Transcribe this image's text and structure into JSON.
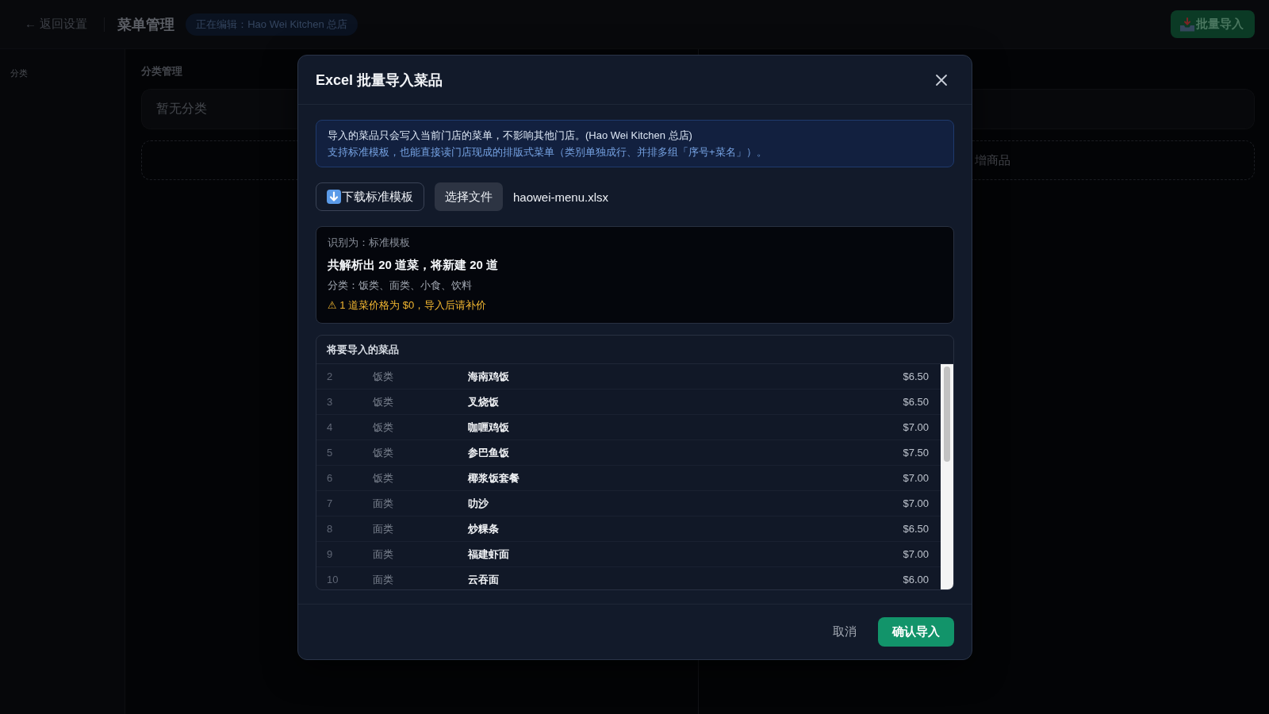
{
  "top_bar": {
    "back_link": "← 返回设置",
    "title": "菜单管理",
    "editing_badge": "正在编辑：Hao Wei Kitchen 总店",
    "bulk_import_button": "批量导入"
  },
  "sidebar": {
    "label": "分类"
  },
  "category_panel": {
    "title": "分类管理",
    "empty_text": "暂无分类"
  },
  "product_panel": {
    "add_button": "增商品"
  },
  "dialog": {
    "title": "Excel 批量导入菜品",
    "notice": {
      "line_1": "导入的菜品只会写入当前门店的菜单，不影响其他门店。(Hao Wei Kitchen 总店)",
      "line_2": "支持标准模板，也能直接读门店现成的排版式菜单（类别单独成行、并排多组「序号+菜名」）。"
    },
    "download_button": "下载标准模板",
    "choose_file_button": "选择文件",
    "file_name": "haowei-menu.xlsx",
    "summary": {
      "detected": "识别为：标准模板",
      "headline": "共解析出 20 道菜，将新建 20 道",
      "categories": "分类：饭类、面类、小食、饮料",
      "warning": "⚠ 1 道菜价格为 $0，导入后请补价"
    },
    "preview": {
      "title": "将要导入的菜品",
      "rows": [
        {
          "number": "2",
          "category": "饭类",
          "name": "海南鸡饭",
          "price": "$6.50"
        },
        {
          "number": "3",
          "category": "饭类",
          "name": "叉烧饭",
          "price": "$6.50"
        },
        {
          "number": "4",
          "category": "饭类",
          "name": "咖喱鸡饭",
          "price": "$7.00"
        },
        {
          "number": "5",
          "category": "饭类",
          "name": "参巴鱼饭",
          "price": "$7.50"
        },
        {
          "number": "6",
          "category": "饭类",
          "name": "椰浆饭套餐",
          "price": "$7.00"
        },
        {
          "number": "7",
          "category": "面类",
          "name": "叻沙",
          "price": "$7.00"
        },
        {
          "number": "8",
          "category": "面类",
          "name": "炒粿条",
          "price": "$6.50"
        },
        {
          "number": "9",
          "category": "面类",
          "name": "福建虾面",
          "price": "$7.00"
        },
        {
          "number": "10",
          "category": "面类",
          "name": "云吞面",
          "price": "$6.00"
        }
      ]
    },
    "cancel_button": "取消",
    "confirm_button": "确认导入"
  }
}
